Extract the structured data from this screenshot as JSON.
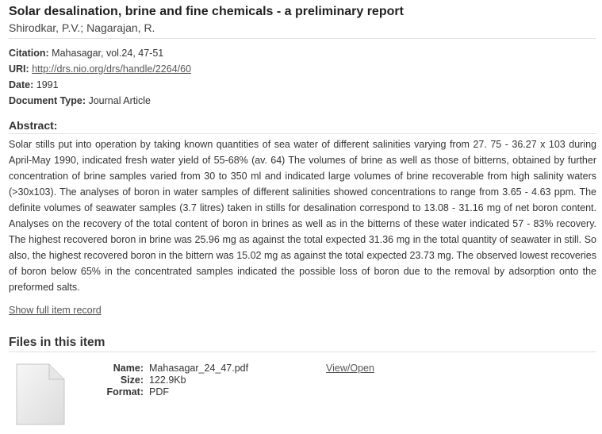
{
  "item": {
    "title": "Solar desalination, brine and fine chemicals - a preliminary report",
    "authors": "Shirodkar, P.V.; Nagarajan, R."
  },
  "metadata": {
    "citation_label": "Citation:",
    "citation_value": "Mahasagar, vol.24, 47-51",
    "uri_label": "URI:",
    "uri_value": "http://drs.nio.org/drs/handle/2264/60",
    "date_label": "Date:",
    "date_value": "1991",
    "doctype_label": "Document Type:",
    "doctype_value": "Journal Article"
  },
  "abstract": {
    "heading": "Abstract:",
    "text": "Solar stills put into operation by taking known quantities of sea water of different salinities varying from 27. 75 - 36.27 x 103 during April-May 1990, indicated fresh water yield of 55-68% (av. 64) The volumes of brine as well as those of bitterns, obtained by further concentration of brine samples varied from 30 to 350 ml and indicated large volumes of brine recoverable from high salinity waters (>30x103). The analyses of boron in water samples of different salinities showed concentrations to range from 3.65 - 4.63 ppm. The definite volumes of seawater samples (3.7 litres) taken in stills for desalination correspond to 13.08 - 31.16 mg of net boron content. Analyses on the recovery of the total content of boron in brines as well as in the bitterns of these water indicated 57 - 83% recovery. The highest recovered boron in brine was 25.96 mg as against the total expected 31.36 mg in the total quantity of seawater in still. So also, the highest recovered boron in the bittern was 15.02 mg as against the total expected 23.73 mg. The observed lowest recoveries of boron below 65% in the concentrated samples indicated the possible loss of boron due to the removal by adsorption onto the preformed salts."
  },
  "links": {
    "full_record": "Show full item record"
  },
  "files": {
    "heading": "Files in this item",
    "icon": "document-icon",
    "name_label": "Name:",
    "name_value": "Mahasagar_24_47.pdf",
    "size_label": "Size:",
    "size_value": "122.9Kb",
    "format_label": "Format:",
    "format_value": "PDF",
    "view_open": "View/Open"
  }
}
